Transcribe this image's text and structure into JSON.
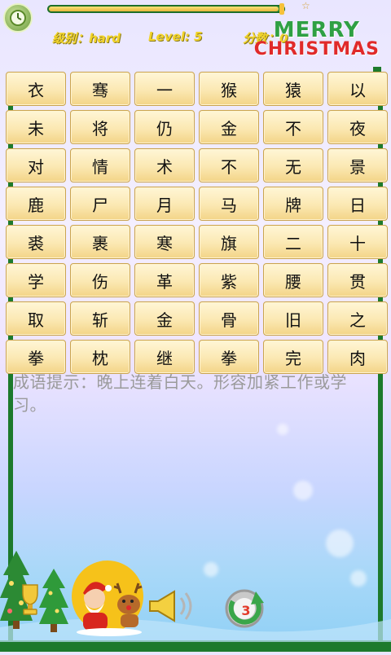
{
  "header": {
    "difficulty_label": "级别：hard",
    "level_label": "Level: 5",
    "score_label": "分数：0",
    "timer_progress": 0.98,
    "title_line1": "MERRY",
    "title_line2": "CHRISTMAS"
  },
  "grid": {
    "rows": [
      [
        "衣",
        "骞",
        "一",
        "猴",
        "猿",
        "以"
      ],
      [
        "未",
        "将",
        "仍",
        "金",
        "不",
        "夜"
      ],
      [
        "对",
        "情",
        "术",
        "不",
        "无",
        "景"
      ],
      [
        "鹿",
        "尸",
        "月",
        "马",
        "牌",
        "日"
      ],
      [
        "裘",
        "裹",
        "寒",
        "旗",
        "二",
        "十"
      ],
      [
        "学",
        "伤",
        "革",
        "紫",
        "腰",
        "贯"
      ],
      [
        "取",
        "斩",
        "金",
        "骨",
        "旧",
        "之"
      ],
      [
        "拳",
        "枕",
        "继",
        "拳",
        "完",
        "肉"
      ]
    ]
  },
  "hint": {
    "text": "成语提示：晚上连着白天。形容加紧工作或学习。"
  },
  "footer": {
    "refresh_count": "3"
  },
  "icons": {
    "clock": "clock-icon",
    "trophy": "trophy-icon",
    "sound": "horn-icon",
    "refresh": "refresh-icon"
  },
  "colors": {
    "frame": "#1d7a2c",
    "tile": "#fbe8b2",
    "info_text": "#f2d42a",
    "hint_text": "#9a9a9a"
  }
}
